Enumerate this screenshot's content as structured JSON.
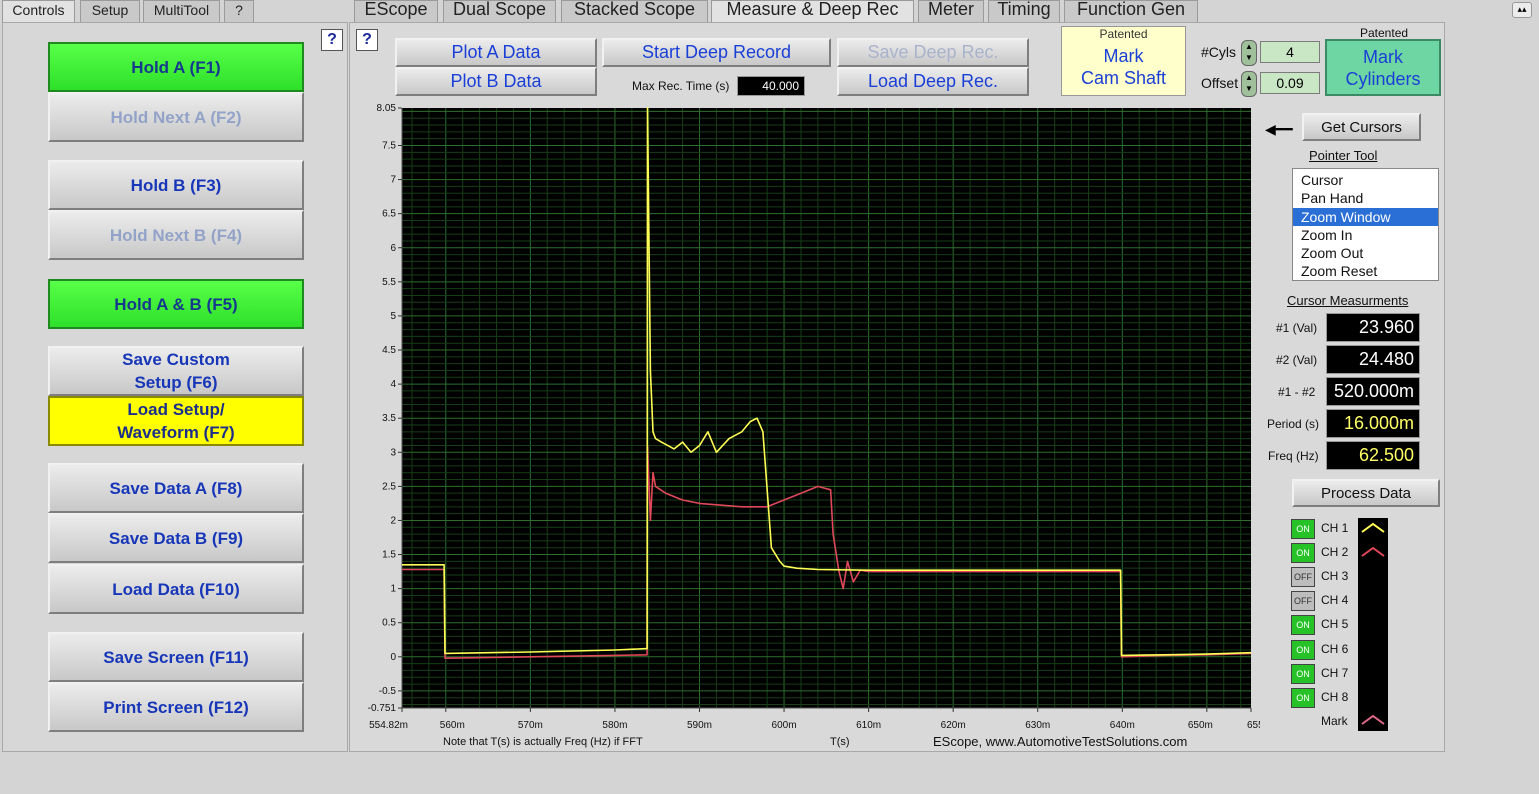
{
  "tabs_left": [
    "Controls",
    "Setup",
    "MultiTool",
    "?"
  ],
  "tabs_main": [
    "EScope",
    "Dual Scope",
    "Stacked Scope",
    "Measure & Deep Rec",
    "Meter",
    "Timing",
    "Function Gen"
  ],
  "left_buttons": {
    "hold_a": "Hold A (F1)",
    "hold_next_a": "Hold Next A (F2)",
    "hold_b": "Hold B (F3)",
    "hold_next_b": "Hold Next B (F4)",
    "hold_ab": "Hold A & B (F5)",
    "save_custom_1": "Save Custom",
    "save_custom_2": "Setup (F6)",
    "load_setup_1": "Load Setup/",
    "load_setup_2": "Waveform (F7)",
    "save_a": "Save Data A (F8)",
    "save_b": "Save Data B (F9)",
    "load_data": "Load Data (F10)",
    "save_screen": "Save Screen (F11)",
    "print_screen": "Print Screen (F12)"
  },
  "help": "?",
  "top": {
    "plot_a": "Plot A Data",
    "plot_b": "Plot B Data",
    "start_deep": "Start Deep Record",
    "max_rec_label": "Max Rec. Time (s)",
    "max_rec_value": "40.000",
    "save_deep": "Save Deep Rec.",
    "load_deep": "Load Deep Rec.",
    "patented": "Patented",
    "mark_cam_1": "Mark",
    "mark_cam_2": "Cam Shaft",
    "cyls_label": "#Cyls",
    "cyls_value": "4",
    "offset_label": "Offset",
    "offset_value": "0.09",
    "mark_cyl_1": "Mark",
    "mark_cyl_2": "Cylinders"
  },
  "right": {
    "get_cursors": "Get Cursors",
    "pointer_tool": "Pointer Tool",
    "pointer_options": [
      "Cursor",
      "Pan Hand",
      "Zoom Window",
      "Zoom In",
      "Zoom Out",
      "Zoom Reset"
    ],
    "pointer_selected": "Zoom Window",
    "cursor_meas": "Cursor Measurments",
    "measurements": [
      {
        "label": "#1 (Val)",
        "value": "23.960"
      },
      {
        "label": "#2 (Val)",
        "value": "24.480"
      },
      {
        "label": "#1 - #2",
        "value": "520.000m"
      },
      {
        "label": "Period (s)",
        "value": "16.000m"
      },
      {
        "label": "Freq (Hz)",
        "value": "62.500"
      }
    ],
    "process_data": "Process Data",
    "channels": [
      {
        "state": "ON",
        "name": "CH 1"
      },
      {
        "state": "ON",
        "name": "CH 2"
      },
      {
        "state": "OFF",
        "name": "CH 3"
      },
      {
        "state": "OFF",
        "name": "CH 4"
      },
      {
        "state": "ON",
        "name": "CH 5"
      },
      {
        "state": "ON",
        "name": "CH 6"
      },
      {
        "state": "ON",
        "name": "CH 7"
      },
      {
        "state": "ON",
        "name": "CH 8"
      }
    ],
    "mark_label": "Mark"
  },
  "footer": {
    "note": "Note that T(s) is actually Freq (Hz) if FFT",
    "xlabel": "T(s)",
    "credit": "EScope, www.AutomotiveTestSolutions.com"
  },
  "colors": {
    "ch1": "#ffff55",
    "ch2": "#e0485a",
    "plot_bg": "#000000",
    "grid": "#1f5a1f"
  },
  "chart_data": {
    "type": "line",
    "x_tick_labels": [
      "554.82m",
      "560m",
      "570m",
      "580m",
      "590m",
      "600m",
      "610m",
      "620m",
      "630m",
      "640m",
      "650m",
      "655.22m"
    ],
    "y_tick_labels": [
      "8.05",
      "7.5",
      "7",
      "6.5",
      "6",
      "5.5",
      "5",
      "4.5",
      "4",
      "3.5",
      "3",
      "2.5",
      "2",
      "1.5",
      "1",
      "0.5",
      "0",
      "-0.5",
      "-0.751"
    ],
    "xlim": [
      0.55482,
      0.65522
    ],
    "ylim": [
      -0.751,
      8.05
    ],
    "grid": true,
    "series": [
      {
        "name": "CH 1",
        "x": [
          0.55482,
          0.5598,
          0.5599,
          0.57,
          0.58,
          0.5838,
          0.58385,
          0.5842,
          0.5845,
          0.5848,
          0.5855,
          0.587,
          0.588,
          0.589,
          0.59,
          0.591,
          0.592,
          0.5935,
          0.595,
          0.596,
          0.5968,
          0.5975,
          0.5985,
          0.5995,
          0.6,
          0.6015,
          0.604,
          0.61,
          0.62,
          0.63,
          0.6398,
          0.6399,
          0.645,
          0.65,
          0.65522
        ],
        "y": [
          1.35,
          1.35,
          0.05,
          0.07,
          0.1,
          0.12,
          8.05,
          4.2,
          3.3,
          3.2,
          3.15,
          3.05,
          3.15,
          3.0,
          3.1,
          3.3,
          3.0,
          3.2,
          3.3,
          3.45,
          3.5,
          3.3,
          1.6,
          1.4,
          1.33,
          1.3,
          1.28,
          1.27,
          1.27,
          1.27,
          1.27,
          0.02,
          0.03,
          0.04,
          0.06
        ]
      },
      {
        "name": "CH 2",
        "x": [
          0.55482,
          0.5598,
          0.5599,
          0.57,
          0.58,
          0.5838,
          0.58385,
          0.5842,
          0.5845,
          0.5848,
          0.586,
          0.588,
          0.59,
          0.595,
          0.598,
          0.6,
          0.602,
          0.604,
          0.6055,
          0.6058,
          0.6065,
          0.607,
          0.6075,
          0.6082,
          0.609,
          0.61,
          0.62,
          0.63,
          0.6398,
          0.6399,
          0.645,
          0.65,
          0.65522
        ],
        "y": [
          1.28,
          1.28,
          -0.02,
          0.0,
          0.02,
          0.03,
          3.1,
          2.0,
          2.7,
          2.5,
          2.4,
          2.3,
          2.25,
          2.2,
          2.2,
          2.3,
          2.4,
          2.5,
          2.45,
          1.8,
          1.25,
          1.0,
          1.4,
          1.1,
          1.27,
          1.25,
          1.25,
          1.25,
          1.25,
          0.0,
          0.02,
          0.03,
          0.05
        ]
      }
    ]
  }
}
